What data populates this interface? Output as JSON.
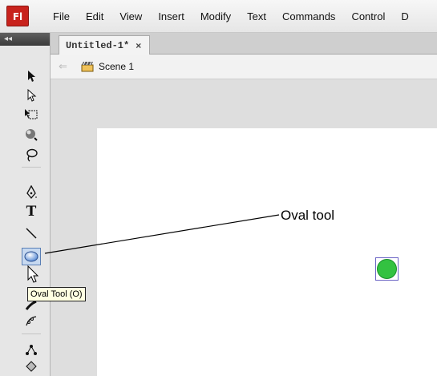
{
  "app": {
    "logo_text": "Fl"
  },
  "menu": [
    "File",
    "Edit",
    "View",
    "Insert",
    "Modify",
    "Text",
    "Commands",
    "Control",
    "D"
  ],
  "document_tab": {
    "title": "Untitled-1*",
    "close_label": "×"
  },
  "editbar": {
    "scene_label": "Scene 1"
  },
  "tools": [
    {
      "name": "selection-tool",
      "icon": "black-arrow-icon"
    },
    {
      "name": "subselection-tool",
      "icon": "white-arrow-icon"
    },
    {
      "name": "free-transform-tool",
      "icon": "transform-icon"
    },
    {
      "name": "3d-rotation-tool",
      "icon": "3d-sphere-icon"
    },
    {
      "name": "lasso-tool",
      "icon": "lasso-icon"
    },
    {
      "name": "pen-tool",
      "icon": "pen-icon"
    },
    {
      "name": "text-tool",
      "icon": "text-icon",
      "label": "T"
    },
    {
      "name": "line-tool",
      "icon": "line-icon"
    },
    {
      "name": "oval-tool",
      "icon": "oval-icon",
      "active": true
    },
    {
      "name": "pencil-tool",
      "icon": "pencil-icon"
    },
    {
      "name": "deco-tool",
      "icon": "deco-icon"
    },
    {
      "name": "bone-tool",
      "icon": "bone-icon"
    },
    {
      "name": "paint-bucket-tool",
      "icon": "bucket-icon"
    }
  ],
  "tooltip": {
    "text": "Oval Tool (O)"
  },
  "annotation": {
    "text": "Oval tool"
  },
  "colors": {
    "stage": "#ffffff",
    "circle_fill": "#33c241",
    "selection_box": "#6a63c4",
    "logo": "#c8231d"
  }
}
